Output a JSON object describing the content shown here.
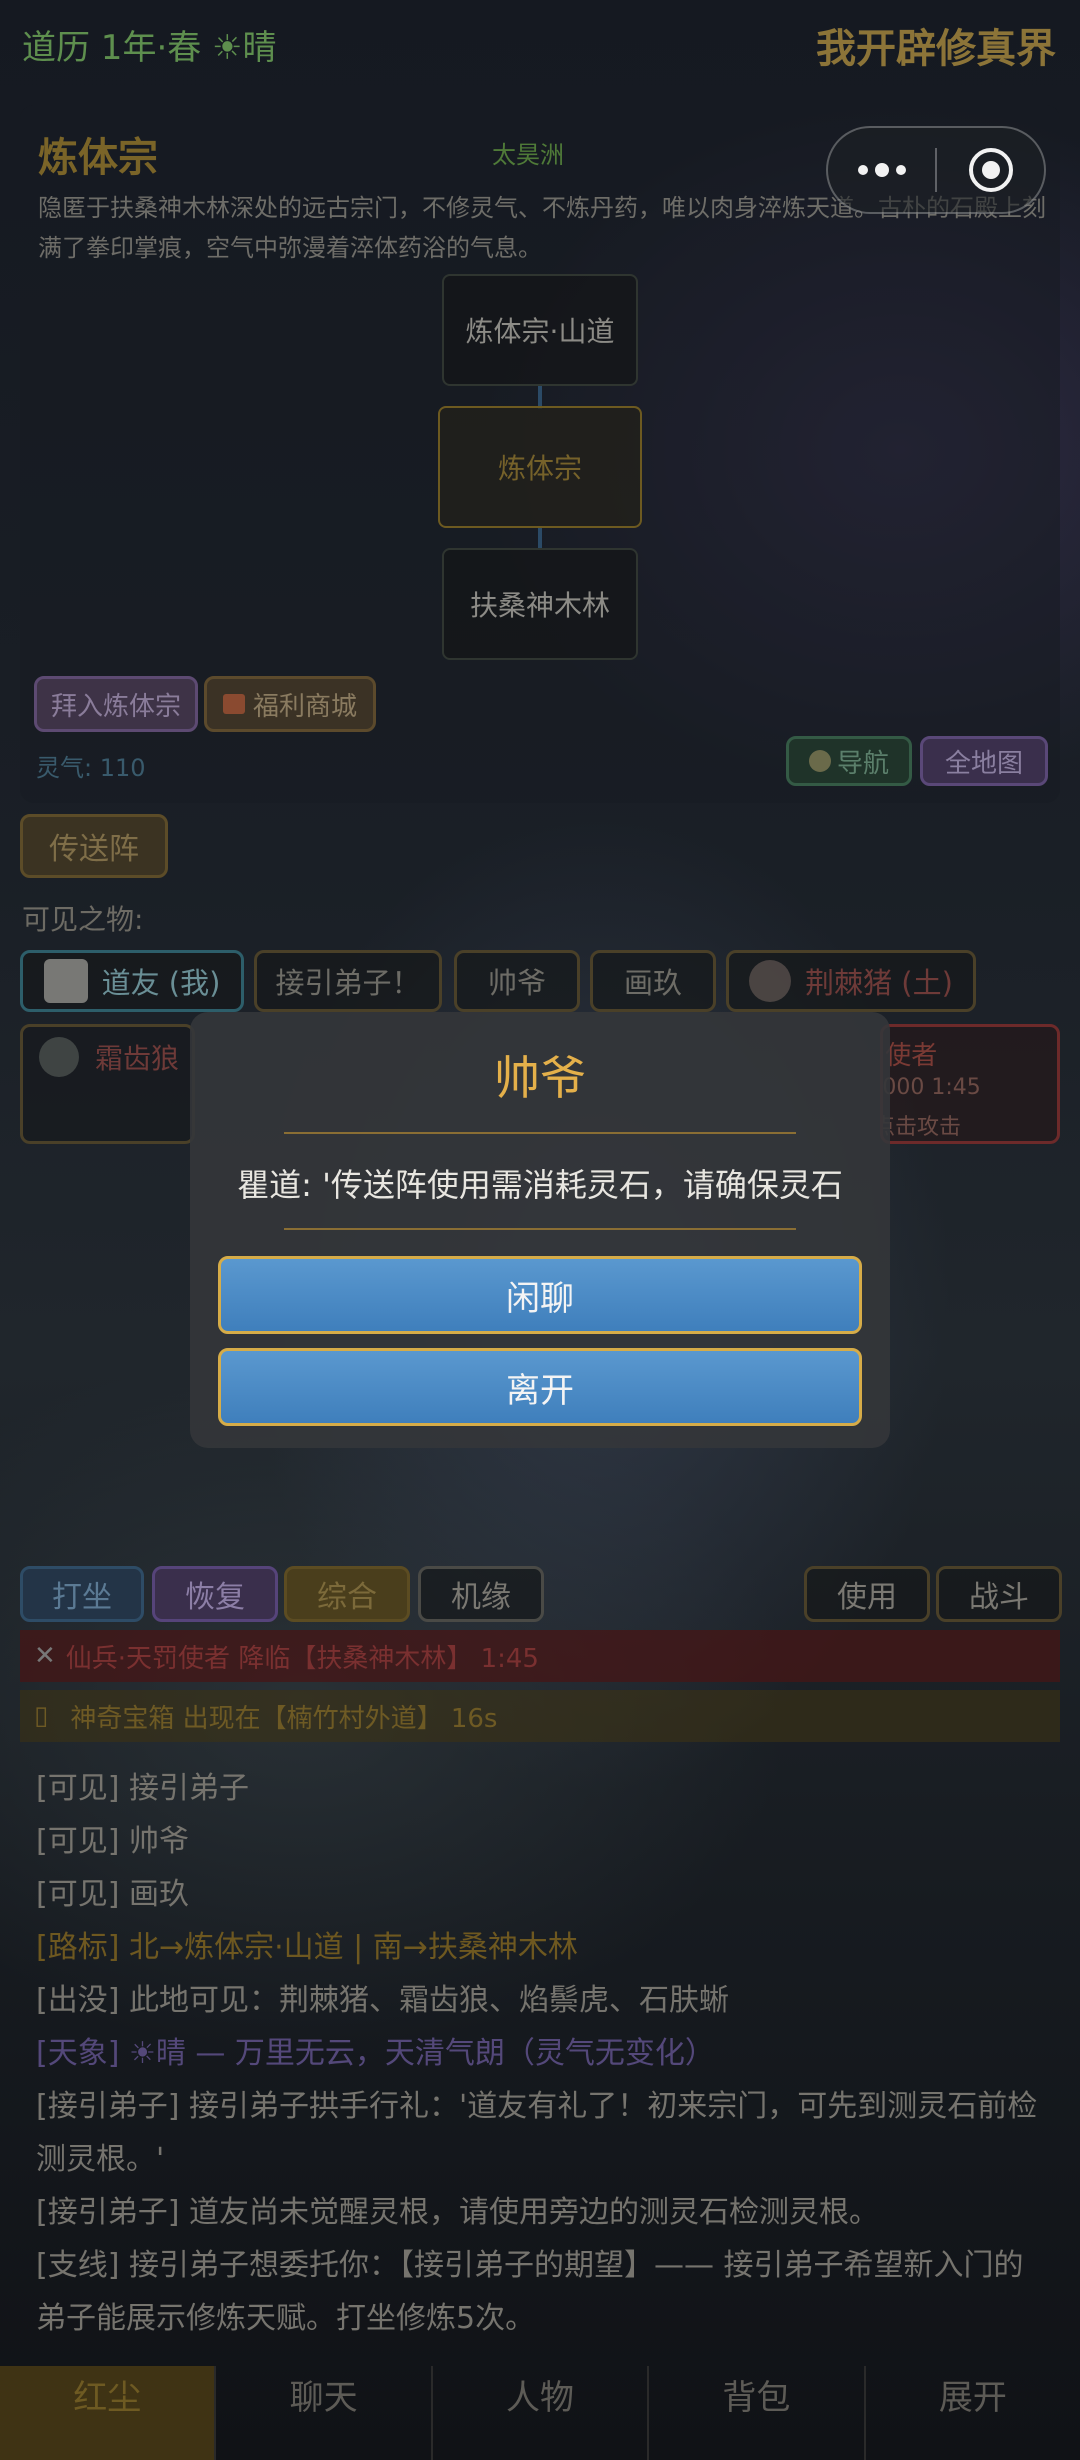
{
  "topbar": {
    "date": "道历 1年·春 ☀晴",
    "app_title": "我开辟修真界"
  },
  "sect": {
    "name": "炼体宗",
    "region": "太昊洲",
    "description": "隐匿于扶桑神木林深处的远古宗门，不修灵气、不炼丹药，唯以肉身淬炼天道。古朴的石殿上刻满了拳印掌痕，空气中弥漫着淬体药浴的气息。",
    "map_nodes": [
      "炼体宗·山道",
      "炼体宗",
      "扶桑神木林"
    ],
    "join_label": "拜入炼体宗",
    "shop_label": "福利商城",
    "lingqi": "灵气: 110",
    "nav_label": "导航",
    "worldmap_label": "全地图"
  },
  "teleport_label": "传送阵",
  "visible_label": "可见之物:",
  "chips": {
    "me": "道友 (我)",
    "a": "接引弟子！",
    "b": "帅爷",
    "c": "画玖",
    "d": "荆棘猪 (土)"
  },
  "monster_left": {
    "name": "霜齿狼"
  },
  "monster_right": {
    "name": "仙兵·天罚使者",
    "hp": "/1000  1:45",
    "hint": "点击攻击"
  },
  "dialog": {
    "title": "帅爷",
    "text": "瞿道: '传送阵使用需消耗灵石，请确保灵石",
    "chat_label": "闲聊",
    "leave_label": "离开"
  },
  "tabs": {
    "sit": "打坐",
    "recover": "恢复",
    "all": "综合",
    "luck": "机缘",
    "use": "使用",
    "fight": "战斗"
  },
  "banners": {
    "red": "仙兵·天罚使者 降临【扶桑神木林】 1:45",
    "red_icon": "✕",
    "gold": "神奇宝箱 出现在【楠竹村外道】 16s",
    "gold_icon": "▯"
  },
  "log": [
    "[可见] 接引弟子",
    "[可见] 帅爷",
    "[可见] 画玖",
    "[路标] 北→炼体宗·山道 | 南→扶桑神木林",
    "[出没] 此地可见：荆棘猪、霜齿狼、焰鬃虎、石肤蜥",
    "[天象] ☀晴 — 万里无云，天清气朗（灵气无变化）",
    "[接引弟子] 接引弟子拱手行礼：'道友有礼了！初来宗门，可先到测灵石前检测灵根。'",
    "[接引弟子] 道友尚未觉醒灵根，请使用旁边的测灵石检测灵根。",
    "[支线] 接引弟子想委托你：【接引弟子的期望】—— 接引弟子希望新入门的弟子能展示修炼天赋。打坐修炼5次。"
  ],
  "bottom_nav": [
    "红尘",
    "聊天",
    "人物",
    "背包",
    "展开"
  ]
}
